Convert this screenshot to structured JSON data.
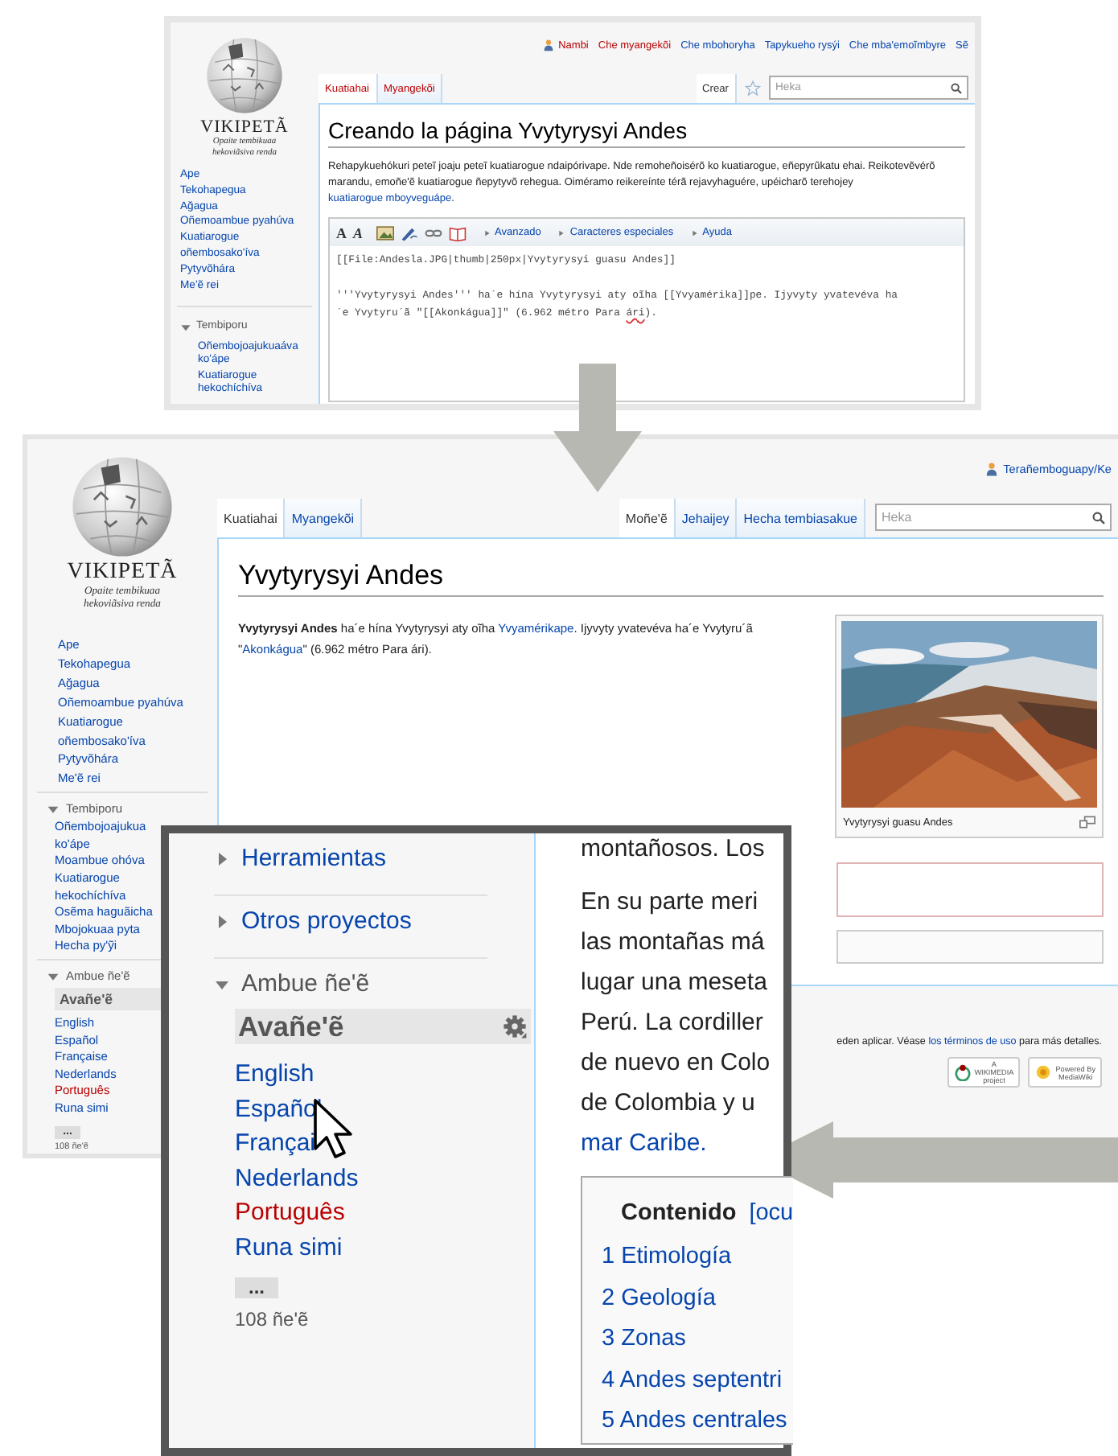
{
  "edit_page": {
    "personal_links": [
      {
        "label": "Nambi",
        "kind": "new"
      },
      {
        "label": "Che myangekõi",
        "kind": "new"
      },
      {
        "label": "Che mbohoryha",
        "kind": "link"
      },
      {
        "label": "Tapykueho rysýi",
        "kind": "link"
      },
      {
        "label": "Che mba'emoĩmbyre",
        "kind": "link"
      },
      {
        "label": "Sẽ",
        "kind": "link"
      }
    ],
    "logo": {
      "wordmark": "VIKIPETÃ",
      "tagline": "Opaite tembikuaa\nhekoviãsiva renda"
    },
    "nav": [
      {
        "label": "Ape"
      },
      {
        "label": "Tekohapegua"
      },
      {
        "label": "Ağagua"
      },
      {
        "label": "Oñemoambue pyahúva"
      },
      {
        "label": "Kuatiarogue\noñembosako'íva"
      },
      {
        "label": "Pytyvõhára"
      },
      {
        "label": "Me'ẽ rei"
      }
    ],
    "sections": [
      {
        "title": "Tembiporu",
        "expanded": true,
        "items": [
          {
            "label": "Oñembojoajukuaáva\nko'ápe",
            "kind": "link"
          },
          {
            "label": "Kuatiarogue\nhekochíchíva",
            "kind": "link"
          }
        ]
      }
    ],
    "tabs_left": [
      {
        "label": "Kuatiahai",
        "selected": true,
        "kind": "new"
      },
      {
        "label": "Myangekõi",
        "selected": false,
        "kind": "new"
      }
    ],
    "tabs_right": [
      {
        "label": "Crear",
        "selected": true,
        "kind": "link"
      }
    ],
    "search": {
      "placeholder": "Heka"
    },
    "heading": "Creando la página Yvytyrysyi Andes",
    "intro": [
      {
        "text": "Rehapykuehókuri peteĩ joaju peteĩ kuatiarogue ndaipórivape. Nde remoheñoisérõ ko kuatiarogue, eñepyrũkatu ehai. Reikotevẽvérõ marandu, emoñe'ẽ kuatiarogue ñepytyvõ rehegua. Oiméramo reikereínte térã rejavyhaguére, upéicharõ terehojey ",
        "kind": "plain"
      },
      {
        "text": "kuatiarogue mboyveguápe",
        "kind": "link"
      },
      {
        "text": ".",
        "kind": "plain"
      }
    ],
    "format_buttons": [
      {
        "label": "A",
        "kind": "bold"
      },
      {
        "label": "A",
        "kind": "italic"
      }
    ],
    "toolbar_menus": [
      {
        "label": "Avanzado"
      },
      {
        "label": "Caracteres especiales"
      },
      {
        "label": "Ayuda"
      }
    ],
    "editor_paragraphs": [
      [
        {
          "text": "[[File:Andesla.JPG|thumb|250px|Yvytyrysyi guasu Andes]]",
          "misspelled": false
        }
      ],
      [
        {
          "text": "'''Yvytyrysyi Andes''' ha´e hína Yvytyrysyi aty oĩha [[Yvyamérika]]pe. Ijyvyty yvatevéva ha\n´e Yvytyru´ã \"[[Akonkágua]]\" (6.962 métro Para ",
          "misspelled": false
        },
        {
          "text": "ári",
          "misspelled": true
        },
        {
          "text": ").",
          "misspelled": false
        }
      ]
    ]
  },
  "article_page": {
    "personal_links": [
      {
        "label": "Terañemboguapy/Ke",
        "kind": "link"
      }
    ],
    "logo": {
      "wordmark": "VIKIPETÃ",
      "tagline": "Opaite tembikuaa\nhekoviãsiva renda"
    },
    "nav": [
      {
        "label": "Ape"
      },
      {
        "label": "Tekohapegua"
      },
      {
        "label": "Ağagua"
      },
      {
        "label": "Oñemoambue pyahúva"
      },
      {
        "label": "Kuatiarogue\noñembosako'íva"
      },
      {
        "label": "Pytyvõhára"
      },
      {
        "label": "Me'ẽ rei"
      }
    ],
    "sections": [
      {
        "title": "Tembiporu",
        "expanded": true,
        "items": [
          {
            "label": "Oñembojoajukua\nko'ápe",
            "kind": "link"
          },
          {
            "label": "Moambue ohóva",
            "kind": "link"
          },
          {
            "label": "Kuatiarogue\nhekochíchíva",
            "kind": "link"
          },
          {
            "label": "Osẽma haguãicha",
            "kind": "link"
          },
          {
            "label": "Mbojokuaa pyta",
            "kind": "link"
          },
          {
            "label": "Hecha py'ỹi",
            "kind": "link"
          }
        ]
      },
      {
        "title": "Ambue ñe'ẽ",
        "expanded": true,
        "current": "Avañe'ẽ",
        "items": [
          {
            "label": "English",
            "kind": "link"
          },
          {
            "label": "Español",
            "kind": "link"
          },
          {
            "label": "Française",
            "kind": "link"
          },
          {
            "label": "Nederlands",
            "kind": "link"
          },
          {
            "label": "Português",
            "kind": "new"
          },
          {
            "label": "Runa simi",
            "kind": "link"
          }
        ],
        "more": "...",
        "count": "108 ñe'ẽ"
      }
    ],
    "tabs_left": [
      {
        "label": "Kuatiahai",
        "selected": true,
        "kind": "link"
      },
      {
        "label": "Myangekõi",
        "selected": false,
        "kind": "link"
      }
    ],
    "tabs_right": [
      {
        "label": "Moñe'ẽ",
        "selected": true,
        "kind": "link"
      },
      {
        "label": "Jehaijey",
        "selected": false,
        "kind": "link"
      },
      {
        "label": "Hecha tembiasakue",
        "selected": false,
        "kind": "link"
      }
    ],
    "search": {
      "placeholder": "Heka"
    },
    "heading": "Yvytyrysyi Andes",
    "intro": [
      {
        "text": "Yvytyrysyi Andes",
        "kind": "bold"
      },
      {
        "text": " ha´e hína Yvytyrysyi aty oĩha ",
        "kind": "plain"
      },
      {
        "text": "Yvyamérikape",
        "kind": "link"
      },
      {
        "text": ". Ijyvyty yvatevéva ha´e Yvytyru´ã \"",
        "kind": "plain"
      },
      {
        "text": "Akonkágua",
        "kind": "link"
      },
      {
        "text": "\" (6.962 métro Para ári).",
        "kind": "plain"
      }
    ],
    "thumbnail": {
      "kind": "picture",
      "caption": "Yvytyrysyi guasu Andes"
    },
    "footer": {
      "text": [
        {
          "text": "eden aplicar. Véase ",
          "kind": "plain"
        },
        {
          "text": "los términos de uso",
          "kind": "link"
        },
        {
          "text": " para más detalles.",
          "kind": "plain"
        }
      ],
      "badges": [
        {
          "kind": "wikimedia",
          "lines": [
            "A",
            "WIKIMEDIA",
            "project"
          ]
        },
        {
          "kind": "mediawiki",
          "lines": [
            "Powered By",
            "MediaWiki"
          ]
        }
      ]
    }
  },
  "zoom_inset": {
    "sections": [
      {
        "title": "Herramientas",
        "expanded": false
      },
      {
        "title": "Otros proyectos",
        "expanded": false
      },
      {
        "title": "Ambue ñe'ẽ",
        "expanded": true,
        "current": "Avañe'ẽ",
        "items": [
          {
            "label": "English",
            "kind": "link"
          },
          {
            "label": "Español",
            "kind": "link"
          },
          {
            "label": "Françai",
            "kind": "link"
          },
          {
            "label": "Nederlands",
            "kind": "link"
          },
          {
            "label": "Português",
            "kind": "new"
          },
          {
            "label": "Runa simi",
            "kind": "link"
          }
        ],
        "more": "...",
        "count": "108 ñe'ẽ"
      }
    ],
    "paragraphs": [
      [
        {
          "text": "montañosos. Los",
          "kind": "plain"
        }
      ],
      [
        {
          "text": "En su parte meri",
          "kind": "plain"
        },
        {
          "text": "las montañas má",
          "kind": "plain"
        },
        {
          "text": "lugar una meseta",
          "kind": "plain"
        },
        {
          "text": "Perú. La cordiller",
          "kind": "plain"
        },
        {
          "text": "de nuevo en Colo",
          "kind": "plain"
        },
        {
          "text": "de Colombia y u",
          "kind": "plain"
        },
        {
          "text": "mar Caribe.",
          "kind": "link"
        }
      ]
    ],
    "toc": {
      "title": "Contenido",
      "toggle": "[ocu",
      "items": [
        "1 Etimología",
        "2 Geología",
        "3 Zonas",
        "4 Andes septentri",
        "5 Andes centrales"
      ]
    }
  }
}
